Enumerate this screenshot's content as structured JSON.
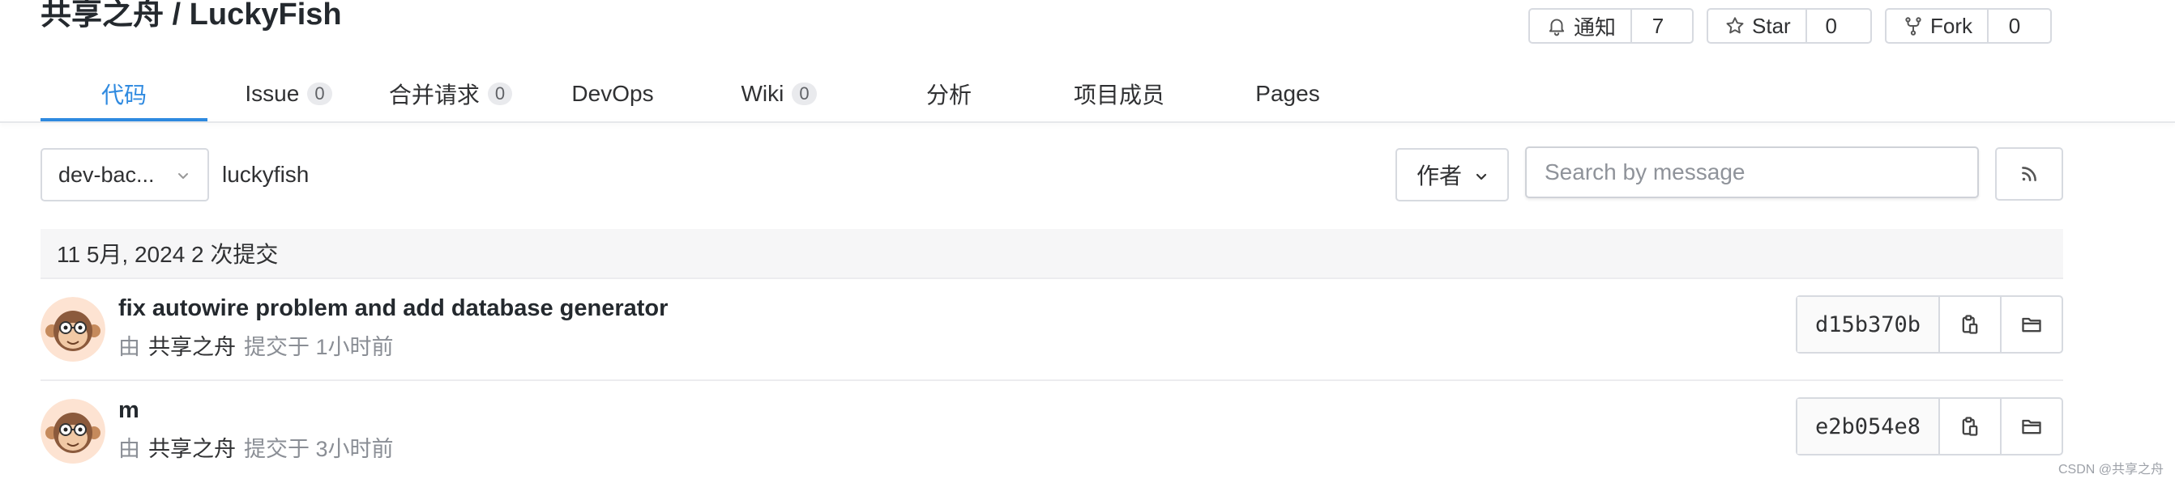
{
  "header": {
    "title": "共享之舟 / LuckyFish",
    "notify": {
      "label": "通知",
      "count": "7"
    },
    "star": {
      "label": "Star",
      "count": "0"
    },
    "fork": {
      "label": "Fork",
      "count": "0"
    }
  },
  "tabs": [
    {
      "label": "代码",
      "badge": "",
      "active": true
    },
    {
      "label": "Issue",
      "badge": "0"
    },
    {
      "label": "合并请求",
      "badge": "0"
    },
    {
      "label": "DevOps",
      "badge": ""
    },
    {
      "label": "Wiki",
      "badge": "0"
    },
    {
      "label": "分析",
      "badge": ""
    },
    {
      "label": "项目成员",
      "badge": ""
    },
    {
      "label": "Pages",
      "badge": ""
    }
  ],
  "toolbar": {
    "branch": "dev-bac...",
    "path": "luckyfish",
    "author_label": "作者",
    "search_placeholder": "Search by message"
  },
  "date_header": "11 5月, 2024 2 次提交",
  "commits": [
    {
      "title": "fix autowire problem and add database generator",
      "by_prefix": "由",
      "author": "共享之舟",
      "time": "提交于 1小时前",
      "hash": "d15b370b"
    },
    {
      "title": "m",
      "by_prefix": "由",
      "author": "共享之舟",
      "time": "提交于 3小时前",
      "hash": "e2b054e8"
    }
  ],
  "watermark": "CSDN @共享之舟",
  "colors": {
    "accent": "#2f8ae0",
    "text": "#303133",
    "muted": "#8a8e95",
    "border": "#d7dae0"
  }
}
